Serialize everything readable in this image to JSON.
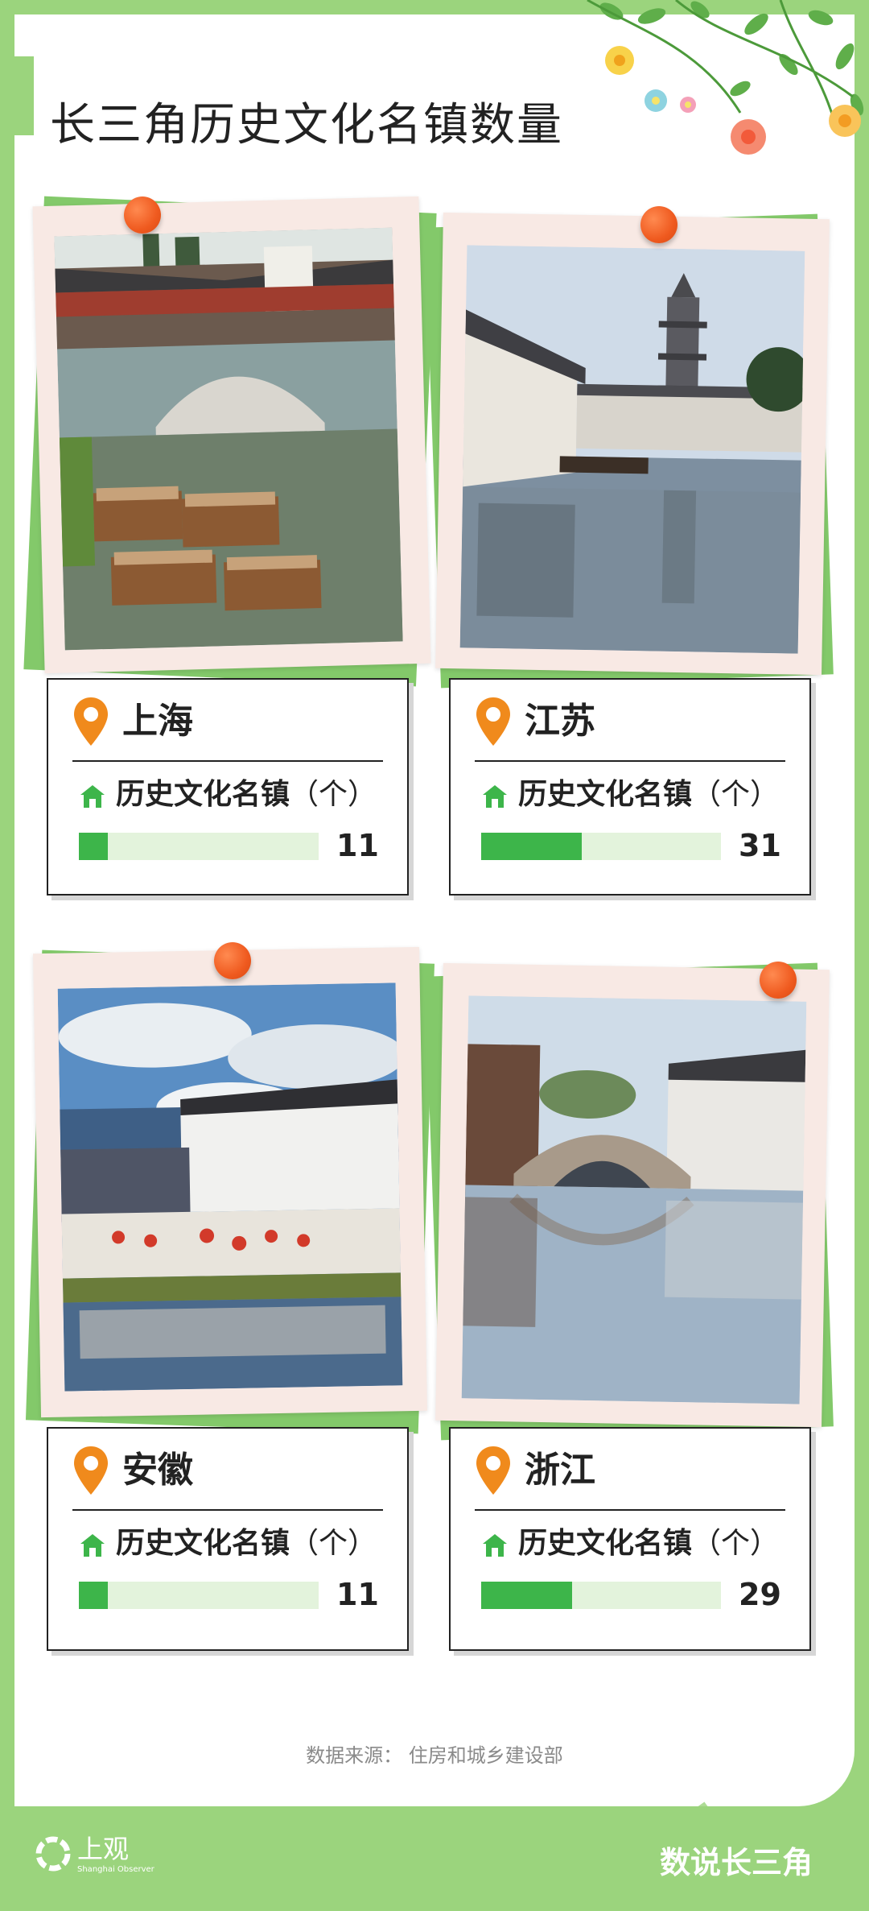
{
  "title": "长三角历史文化名镇数量",
  "metric_label": "历史文化名镇",
  "metric_unit": "（个）",
  "provinces": [
    {
      "name": "上海",
      "count": "11",
      "share": 0.12
    },
    {
      "name": "江苏",
      "count": "31",
      "share": 0.42
    },
    {
      "name": "安徽",
      "count": "11",
      "share": 0.12
    },
    {
      "name": "浙江",
      "count": "29",
      "share": 0.38
    }
  ],
  "source": "数据来源：  住房和城乡建设部",
  "footer": {
    "logo_text": "上观",
    "logo_subtitle": "Shanghai Observer",
    "brand": "数说长三角"
  },
  "colors": {
    "background_green": "#9bd47d",
    "bar_fill": "#3db54a",
    "bar_track": "#e3f3dc",
    "pin_orange": "#f08a1c",
    "pushpin": "#ef5a1f"
  },
  "icons": [
    "location-pin-icon",
    "house-icon",
    "pushpin-icon",
    "flower-decoration",
    "logo-icon"
  ]
}
